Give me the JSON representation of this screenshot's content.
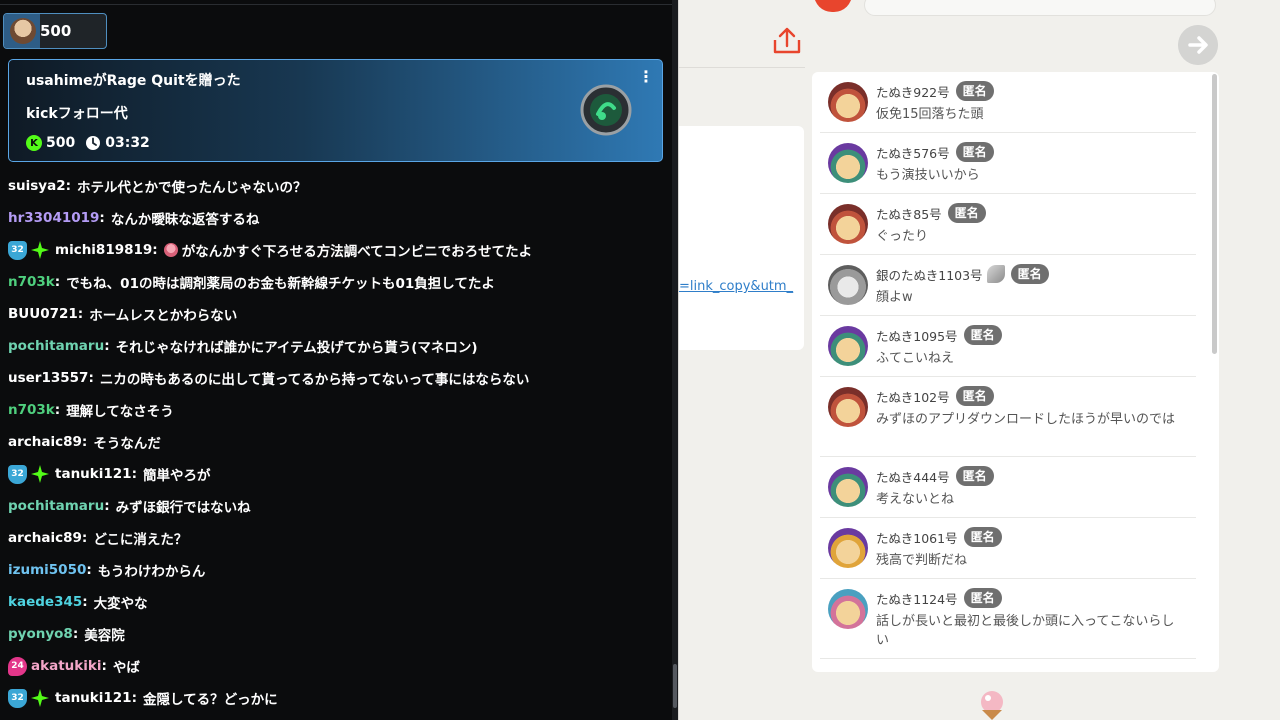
{
  "chat": {
    "balance_amount": "500",
    "balance_fill": 0.35,
    "gift": {
      "title": "usahimeがRage Quitを贈った",
      "message": "kickフォロー代",
      "amount": "500",
      "time": "03:32"
    },
    "messages": [
      {
        "badge": "",
        "star": false,
        "user": "suisya2",
        "color": "#ffffff",
        "text": "ホテル代とかで使ったんじゃないの？"
      },
      {
        "badge": "",
        "star": false,
        "user": "hr33041019",
        "color": "#b49cf5",
        "text": "なんか曖昧な返答するね"
      },
      {
        "badge": "32",
        "star": true,
        "user": "michi819819",
        "color": "#ffffff",
        "text": "がなんかすぐ下ろせる方法調べてコンビニでおろせてたよ",
        "emote": true
      },
      {
        "badge": "",
        "star": false,
        "user": "n703k",
        "color": "#4fd07e",
        "text": "でもね、01の時は調剤薬局のお金も新幹線チケットも01負担してたよ"
      },
      {
        "badge": "",
        "star": false,
        "user": "BUU0721",
        "color": "#ffffff",
        "text": "ホームレスとかわらない"
      },
      {
        "badge": "",
        "star": false,
        "user": "pochitamaru",
        "color": "#6fd3b0",
        "text": "それじゃなければ誰かにアイテム投げてから貰う(マネロン)"
      },
      {
        "badge": "",
        "star": false,
        "user": "user13557",
        "color": "#ffffff",
        "text": "ニカの時もあるのに出して貰ってるから持ってないって事にはならない"
      },
      {
        "badge": "",
        "star": false,
        "user": "n703k",
        "color": "#4fd07e",
        "text": "理解してなさそう"
      },
      {
        "badge": "",
        "star": false,
        "user": "archaic89",
        "color": "#ffffff",
        "text": "そうなんだ"
      },
      {
        "badge": "32",
        "star": true,
        "user": "tanuki121",
        "color": "#ffffff",
        "text": "簡単やろが"
      },
      {
        "badge": "",
        "star": false,
        "user": "pochitamaru",
        "color": "#6fd3b0",
        "text": "みずほ銀行ではないね"
      },
      {
        "badge": "",
        "star": false,
        "user": "archaic89",
        "color": "#ffffff",
        "text": "どこに消えた？"
      },
      {
        "badge": "",
        "star": false,
        "user": "izumi5050",
        "color": "#6fc3f0",
        "text": "もうわけわからん"
      },
      {
        "badge": "",
        "star": false,
        "user": "kaede345",
        "color": "#4fd3e0",
        "text": "大変やな"
      },
      {
        "badge": "",
        "star": false,
        "user": "pyonyo8",
        "color": "#6fd3b0",
        "text": "美容院"
      },
      {
        "badge": "24",
        "star": false,
        "user": "akatukiki",
        "color": "#f3a6c8",
        "text": "やば",
        "pink": true
      },
      {
        "badge": "32",
        "star": true,
        "user": "tanuki121",
        "color": "#ffffff",
        "text": "金隠してる？どっかに"
      }
    ]
  },
  "page": {
    "link_text": "=link_copy&utm_",
    "comments": [
      {
        "name": "たぬき922号",
        "tag": "匿名",
        "text": "仮免15回落ちた頭",
        "avatar": "tanuki-red"
      },
      {
        "name": "たぬき576号",
        "tag": "匿名",
        "text": "もう演技いいから",
        "avatar": "tanuki-green"
      },
      {
        "name": "たぬき85号",
        "tag": "匿名",
        "text": "ぐったり",
        "avatar": "tanuki-red"
      },
      {
        "name": "銀のたぬき1103号",
        "tag": "匿名",
        "text": "顔よw",
        "avatar": "tanuki-silver",
        "medal": true
      },
      {
        "name": "たぬき1095号",
        "tag": "匿名",
        "text": "ふてこいねえ",
        "avatar": "tanuki-green"
      },
      {
        "name": "たぬき102号",
        "tag": "匿名",
        "text": "みずほのアプリダウンロードしたほうが早いのでは",
        "avatar": "tanuki-red",
        "two_line": true
      },
      {
        "name": "たぬき444号",
        "tag": "匿名",
        "text": "考えないとね",
        "avatar": "tanuki-green"
      },
      {
        "name": "たぬき1061号",
        "tag": "匿名",
        "text": "残高で判断だね",
        "avatar": "tanuki-gold"
      },
      {
        "name": "たぬき1124号",
        "tag": "匿名",
        "text": "話しが長いと最初と最後しか頭に入ってこないらしい",
        "avatar": "tanuki-pink",
        "two_line": true
      }
    ]
  },
  "icons": {
    "share": "share-icon",
    "send": "send-arrow-icon",
    "kebab": "more-vertical-icon",
    "clock": "clock-icon",
    "kick_coin": "kick-coin-icon"
  },
  "colors": {
    "chat_bg": "#0b0c0d",
    "gift_border": "#5aa6e6",
    "kick_green": "#53fc18",
    "accent_red": "#e8452d",
    "anon_tag": "#6f6f6f"
  }
}
